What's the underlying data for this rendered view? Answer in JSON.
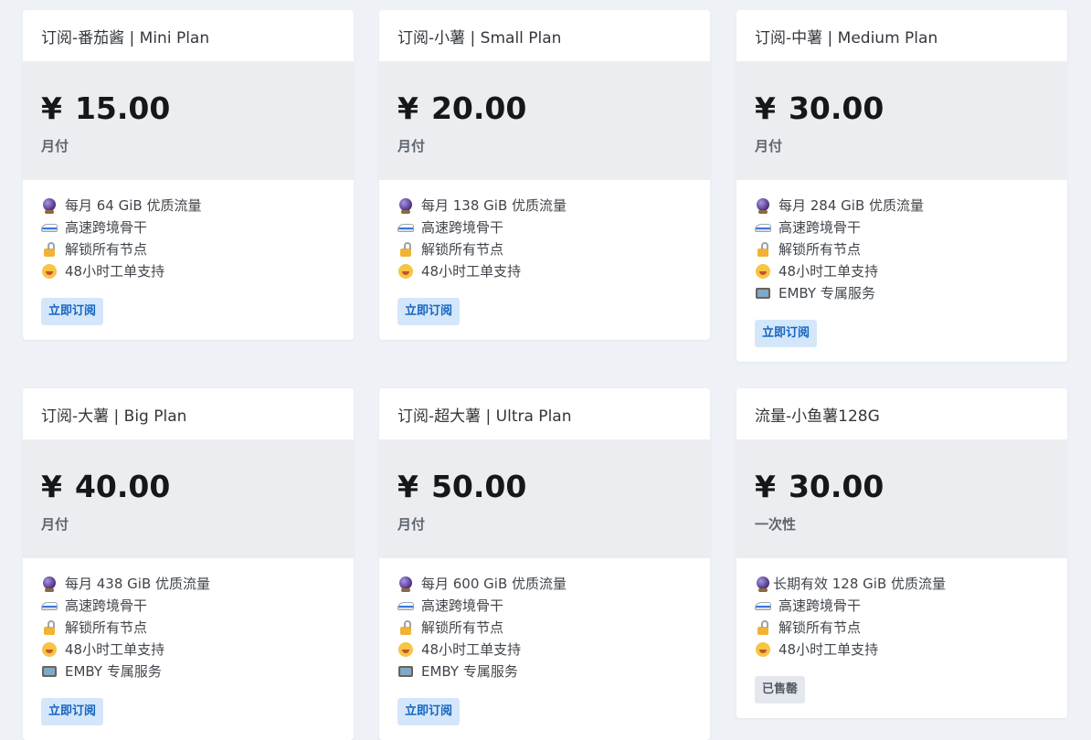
{
  "plans": [
    {
      "title": "订阅-番茄酱 | Mini Plan",
      "currency": "¥",
      "price": "15.00",
      "period": "月付",
      "features": [
        {
          "icon": "crystal-ball-icon",
          "text": "每月 64 GiB 优质流量"
        },
        {
          "icon": "train-icon",
          "text": "高速跨境骨干"
        },
        {
          "icon": "unlocked-icon",
          "text": "解锁所有节点"
        },
        {
          "icon": "face-icon",
          "text": "48小时工单支持"
        }
      ],
      "button": "立即订阅",
      "button_state": "available"
    },
    {
      "title": "订阅-小薯 | Small Plan",
      "currency": "¥",
      "price": "20.00",
      "period": "月付",
      "features": [
        {
          "icon": "crystal-ball-icon",
          "text": "每月 138 GiB 优质流量"
        },
        {
          "icon": "train-icon",
          "text": "高速跨境骨干"
        },
        {
          "icon": "unlocked-icon",
          "text": "解锁所有节点"
        },
        {
          "icon": "face-icon",
          "text": "48小时工单支持"
        }
      ],
      "button": "立即订阅",
      "button_state": "available"
    },
    {
      "title": "订阅-中薯 | Medium Plan",
      "currency": "¥",
      "price": "30.00",
      "period": "月付",
      "features": [
        {
          "icon": "crystal-ball-icon",
          "text": "每月 284 GiB 优质流量"
        },
        {
          "icon": "train-icon",
          "text": "高速跨境骨干"
        },
        {
          "icon": "unlocked-icon",
          "text": "解锁所有节点"
        },
        {
          "icon": "face-icon",
          "text": "48小时工单支持"
        },
        {
          "icon": "tv-icon",
          "text": "EMBY 专属服务"
        }
      ],
      "button": "立即订阅",
      "button_state": "available"
    },
    {
      "title": "订阅-大薯 | Big Plan",
      "currency": "¥",
      "price": "40.00",
      "period": "月付",
      "features": [
        {
          "icon": "crystal-ball-icon",
          "text": "每月 438 GiB 优质流量"
        },
        {
          "icon": "train-icon",
          "text": "高速跨境骨干"
        },
        {
          "icon": "unlocked-icon",
          "text": "解锁所有节点"
        },
        {
          "icon": "face-icon",
          "text": "48小时工单支持"
        },
        {
          "icon": "tv-icon",
          "text": "EMBY 专属服务"
        }
      ],
      "button": "立即订阅",
      "button_state": "available"
    },
    {
      "title": "订阅-超大薯 | Ultra Plan",
      "currency": "¥",
      "price": "50.00",
      "period": "月付",
      "features": [
        {
          "icon": "crystal-ball-icon",
          "text": "每月 600 GiB 优质流量"
        },
        {
          "icon": "train-icon",
          "text": "高速跨境骨干"
        },
        {
          "icon": "unlocked-icon",
          "text": "解锁所有节点"
        },
        {
          "icon": "face-icon",
          "text": "48小时工单支持"
        },
        {
          "icon": "tv-icon",
          "text": "EMBY 专属服务"
        }
      ],
      "button": "立即订阅",
      "button_state": "available"
    },
    {
      "title": "流量-小鱼薯128G",
      "currency": "¥",
      "price": "30.00",
      "period": "一次性",
      "features": [
        {
          "icon": "crystal-ball-icon",
          "text": "长期有效 128 GiB 优质流量"
        },
        {
          "icon": "train-icon",
          "text": "高速跨境骨干"
        },
        {
          "icon": "unlocked-icon",
          "text": "解锁所有节点"
        },
        {
          "icon": "face-icon",
          "text": "48小时工单支持"
        }
      ],
      "button": "已售罄",
      "button_state": "sold-out"
    }
  ]
}
